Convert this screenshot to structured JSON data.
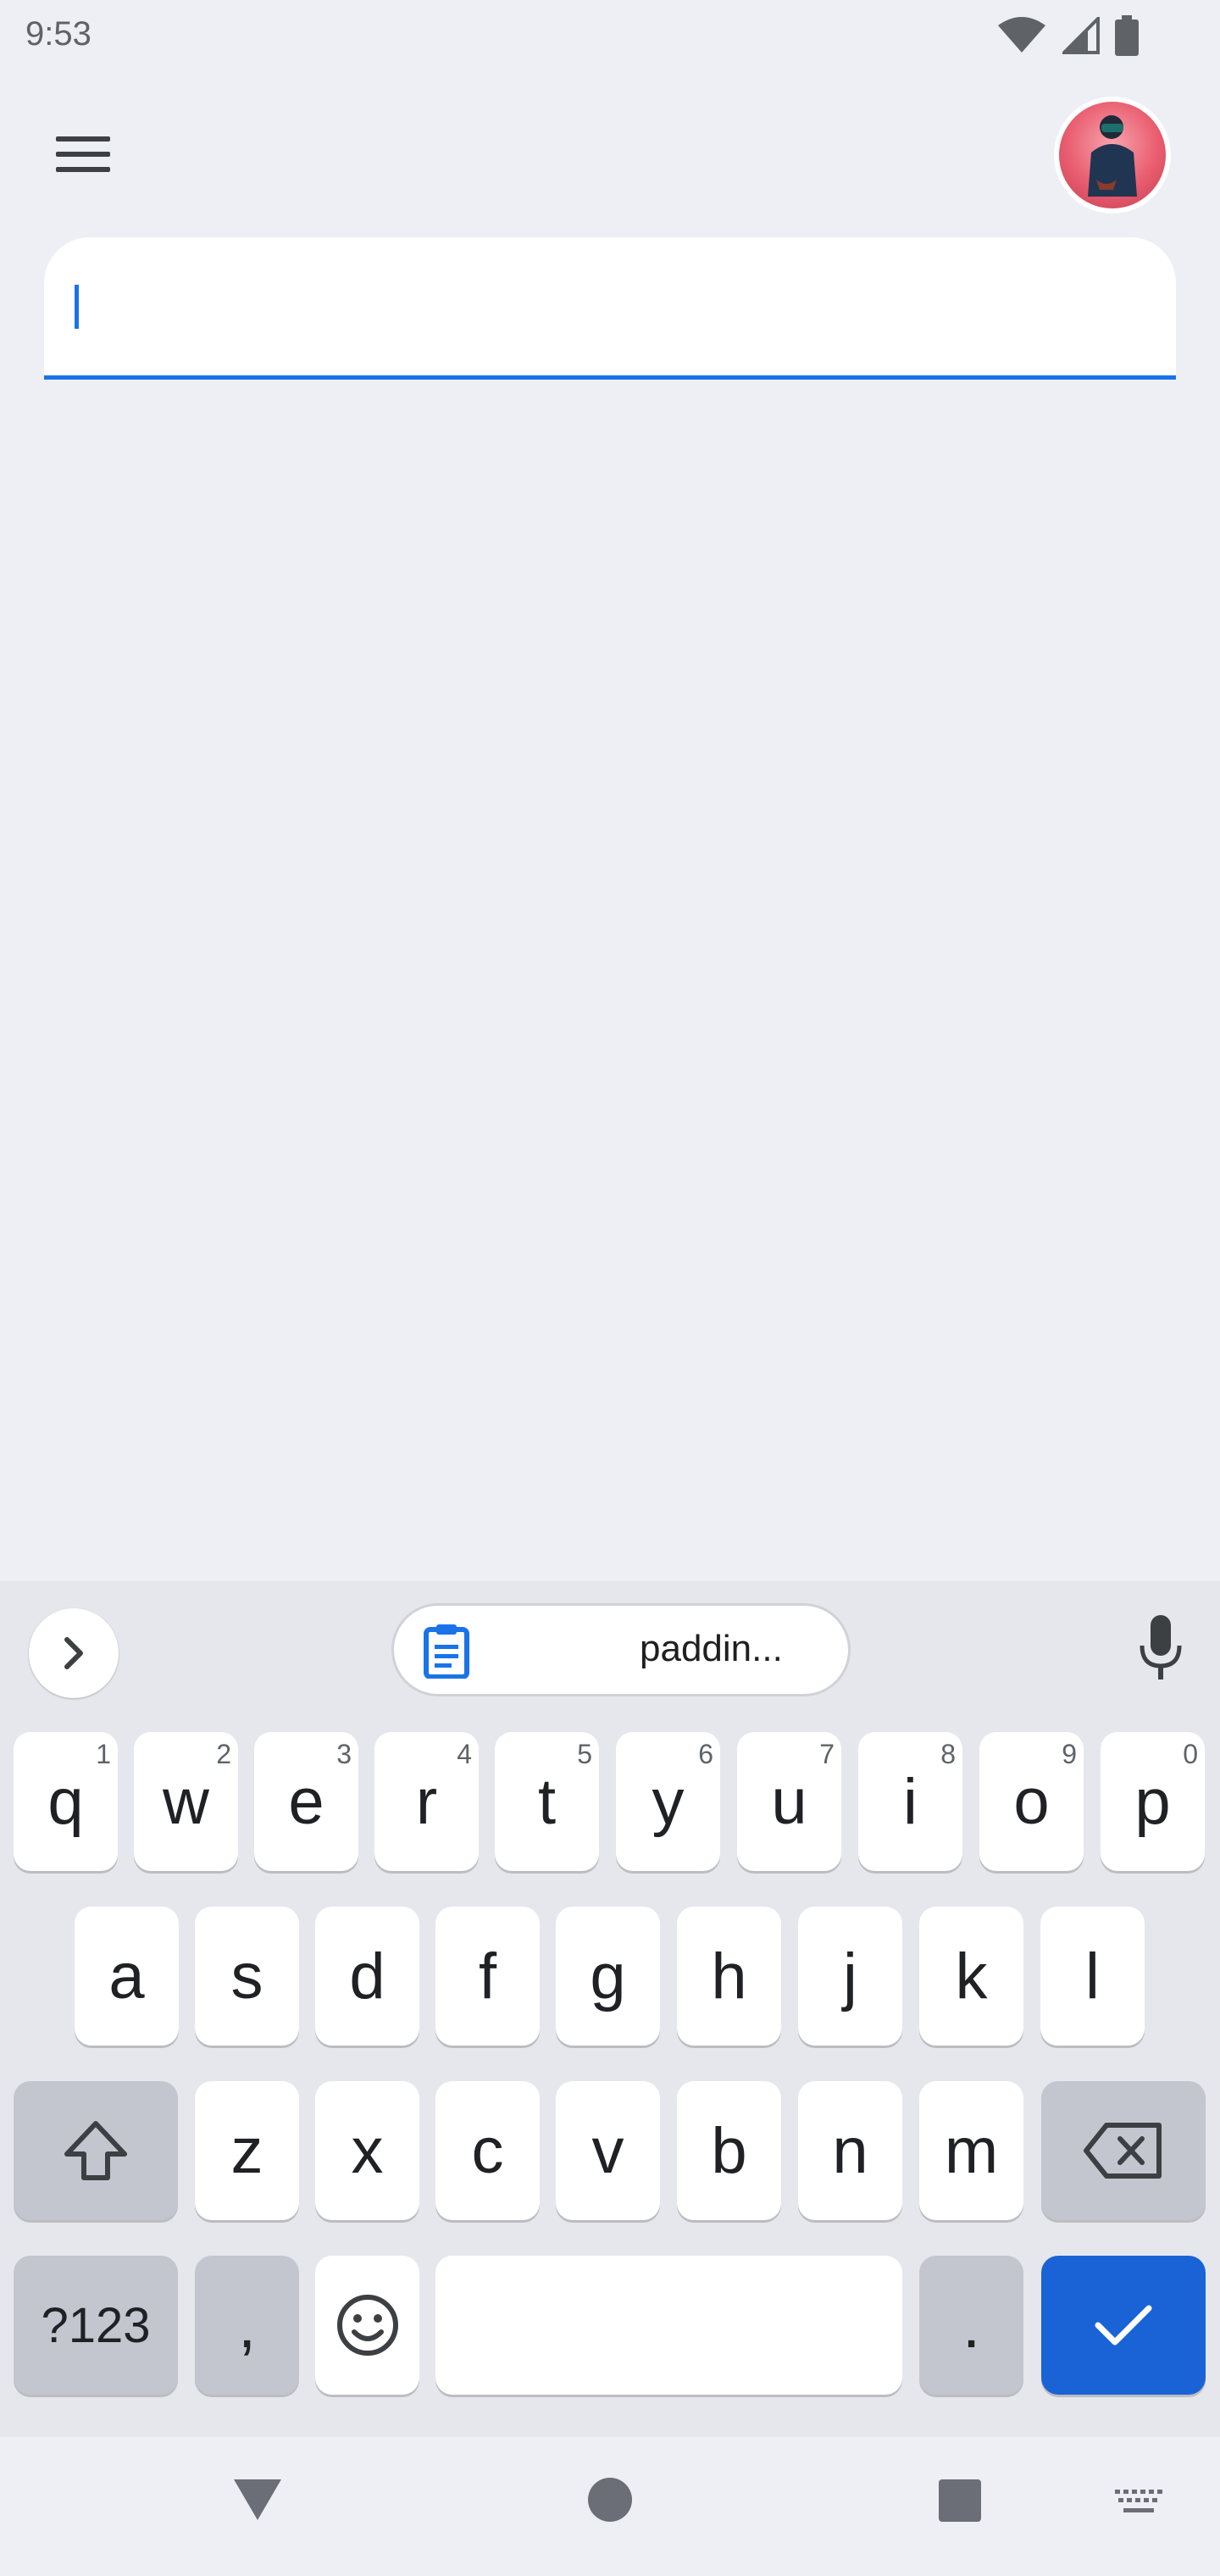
{
  "status_bar": {
    "time": "9:53",
    "icons": [
      "wifi-icon",
      "cell-signal-icon",
      "battery-icon"
    ]
  },
  "app_bar": {
    "menu_icon": "hamburger-menu-icon",
    "avatar": "user-avatar"
  },
  "search": {
    "value": "",
    "placeholder": ""
  },
  "keyboard": {
    "clipboard_suggestion": "paddin...",
    "row1": [
      {
        "key": "q",
        "hint": "1"
      },
      {
        "key": "w",
        "hint": "2"
      },
      {
        "key": "e",
        "hint": "3"
      },
      {
        "key": "r",
        "hint": "4"
      },
      {
        "key": "t",
        "hint": "5"
      },
      {
        "key": "y",
        "hint": "6"
      },
      {
        "key": "u",
        "hint": "7"
      },
      {
        "key": "i",
        "hint": "8"
      },
      {
        "key": "o",
        "hint": "9"
      },
      {
        "key": "p",
        "hint": "0"
      }
    ],
    "row2": [
      "a",
      "s",
      "d",
      "f",
      "g",
      "h",
      "j",
      "k",
      "l"
    ],
    "row3": [
      "z",
      "x",
      "c",
      "v",
      "b",
      "n",
      "m"
    ],
    "symbols_label": "?123",
    "comma": ",",
    "period": ".",
    "colors": {
      "action": "#1a63d6",
      "accent": "#1a73e8"
    }
  },
  "nav_bar": {
    "icons": [
      "back-icon",
      "home-icon",
      "recents-icon",
      "keyboard-switch-icon"
    ]
  }
}
